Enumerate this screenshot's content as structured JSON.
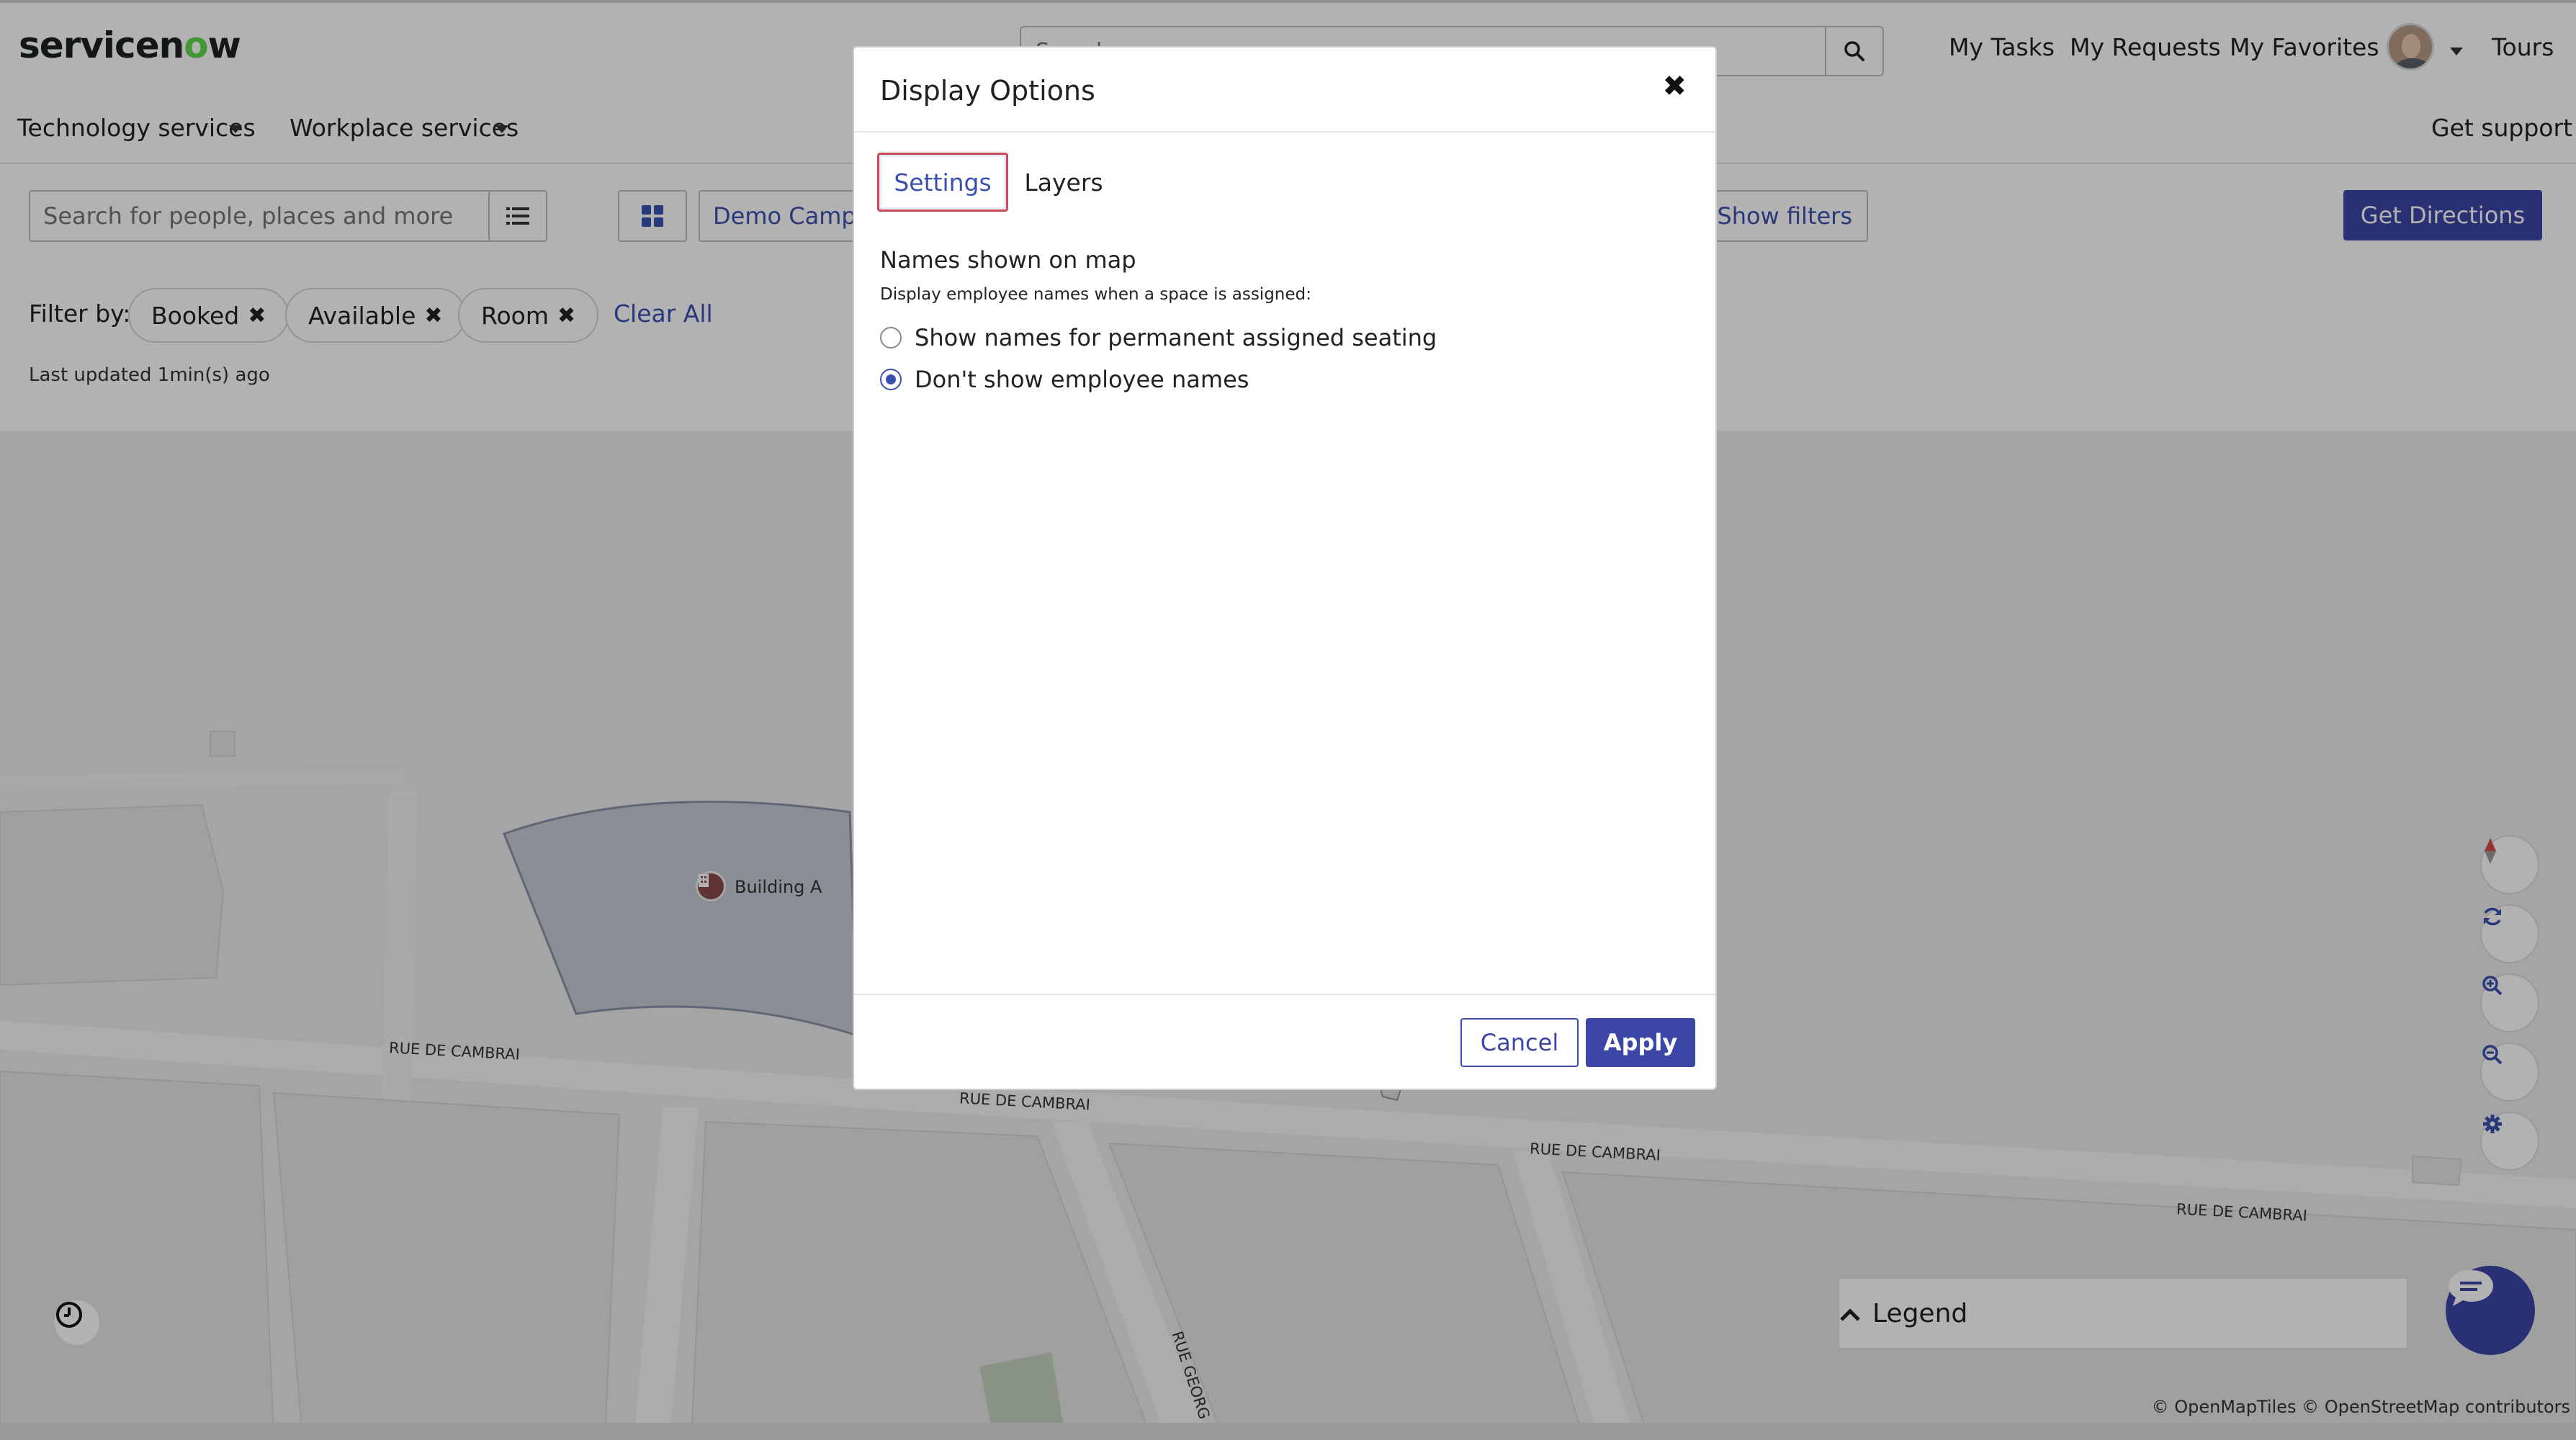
{
  "header": {
    "logo_text": "servicen",
    "logo_o": "o",
    "logo_tail": "w",
    "search_placeholder": "Search",
    "links": [
      "My Tasks",
      "My Requests",
      "My Favorites"
    ],
    "tours": "Tours"
  },
  "nav": {
    "items": [
      "Technology services",
      "Workplace services"
    ],
    "support": "Get support"
  },
  "toolbar": {
    "location_search_placeholder": "Search for people, places and more",
    "campus": "Demo Campus",
    "show_filters": "Show filters",
    "get_directions": "Get Directions",
    "filter_label": "Filter by:",
    "filters": [
      "Booked",
      "Available",
      "Room"
    ],
    "clear_all": "Clear All",
    "last_updated": "Last updated 1min(s) ago"
  },
  "map": {
    "building": "Building A",
    "streets": [
      "RUE DE CAMBRAI",
      "RUE DE CAMBRAI",
      "RUE DE CAMBRAI",
      "RUE DE CAMBRAI",
      "RUE GEORG"
    ],
    "legend": "Legend",
    "attribution": "© OpenMapTiles © OpenStreetMap contributors"
  },
  "modal": {
    "title": "Display Options",
    "tabs": [
      "Settings",
      "Layers"
    ],
    "active_tab": "Settings",
    "section_title": "Names shown on map",
    "section_desc": "Display employee names when a space is assigned:",
    "options": [
      "Show names for permanent assigned seating",
      "Don't show employee names"
    ],
    "selected_option": "Don't show employee names",
    "cancel": "Cancel",
    "apply": "Apply"
  },
  "colors": {
    "accent": "#3b46a6",
    "link": "#3b4fb0",
    "logo_green": "#62d84e",
    "focus_ring": "#c94b5a"
  }
}
